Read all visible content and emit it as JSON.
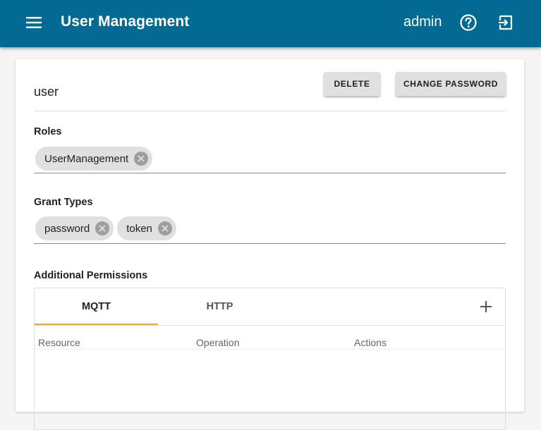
{
  "appbar": {
    "title": "User Management",
    "username": "admin",
    "icons": [
      "menu-icon",
      "help-icon",
      "logout-icon"
    ],
    "color": "#036a93"
  },
  "user": {
    "name": "user",
    "delete_label": "DELETE",
    "change_password_label": "CHANGE PASSWORD"
  },
  "roles": {
    "label": "Roles",
    "chips": [
      "UserManagement"
    ]
  },
  "grant_types": {
    "label": "Grant Types",
    "chips": [
      "password",
      "token"
    ]
  },
  "permissions": {
    "label": "Additional Permissions",
    "tabs": [
      "MQTT",
      "HTTP"
    ],
    "active_tab": "MQTT",
    "columns": [
      "Resource",
      "Operation",
      "Actions"
    ],
    "accent": "#f5a623"
  }
}
